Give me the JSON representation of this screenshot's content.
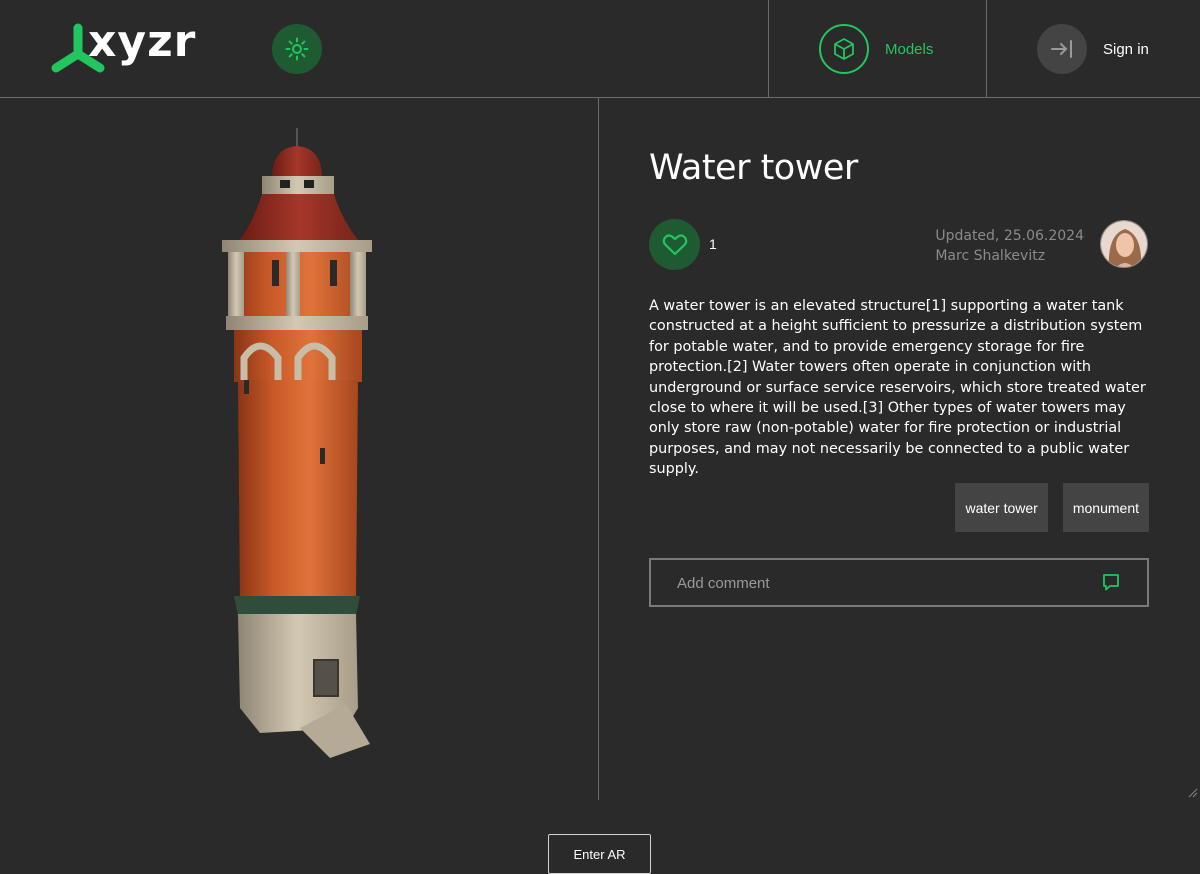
{
  "brand": {
    "logo_text": "xyzr",
    "accent": "#22c55e",
    "accent_dark": "#1e5b33"
  },
  "header": {
    "theme_icon": "sun-icon",
    "nav": {
      "models": {
        "label": "Models",
        "icon": "cube-icon"
      },
      "signin": {
        "label": "Sign in",
        "icon": "sign-in-icon"
      }
    }
  },
  "viewer": {
    "ar_button_label": "Enter AR"
  },
  "model": {
    "title": "Water tower",
    "likes": "1",
    "updated": "Updated, 25.06.2024",
    "author": "Marc Shalkevitz",
    "description": "A water tower is an elevated structure[1] supporting a water tank constructed at a height sufficient to pressurize a distribution system for potable water, and to provide emergency storage for fire protection.[2] Water towers often operate in conjunction with underground or surface service reservoirs, which store treated water close to where it will be used.[3] Other types of water towers may only store raw (non-potable) water for fire protection or industrial purposes, and may not necessarily be connected to a public water supply.",
    "tags": [
      "water tower",
      "monument"
    ]
  },
  "comment": {
    "placeholder": "Add comment"
  }
}
